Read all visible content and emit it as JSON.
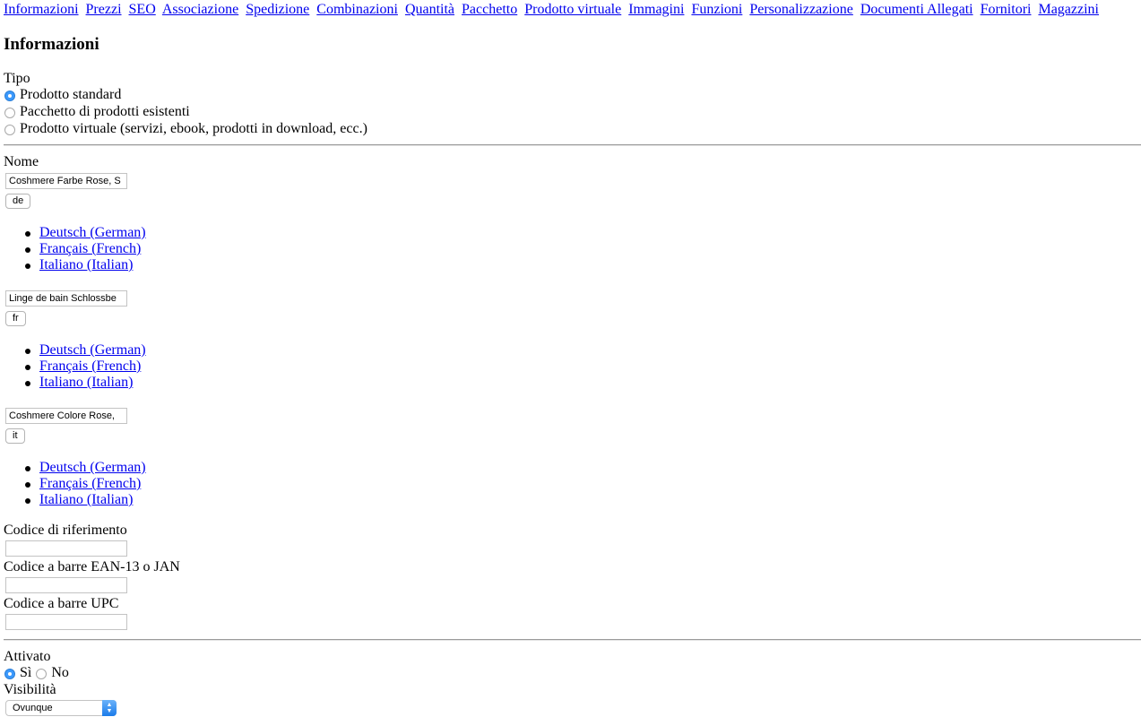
{
  "tabs": [
    "Informazioni",
    "Prezzi",
    "SEO",
    "Associazione",
    "Spedizione",
    "Combinazioni",
    "Quantità",
    "Pacchetto",
    "Prodotto virtuale",
    "Immagini",
    "Funzioni",
    "Personalizzazione",
    "Documenti Allegati",
    "Fornitori",
    "Magazzini"
  ],
  "section_title": "Informazioni",
  "tipo": {
    "label": "Tipo",
    "options": [
      {
        "label": "Prodotto standard",
        "checked": true
      },
      {
        "label": "Pacchetto di prodotti esistenti",
        "checked": false
      },
      {
        "label": "Prodotto virtuale (servizi, ebook, prodotti in download, ecc.)",
        "checked": false
      }
    ]
  },
  "nome": {
    "label": "Nome",
    "fields": [
      {
        "value": "Coshmere Farbe Rose, S",
        "lang_button": "de",
        "languages": [
          "Deutsch (German)",
          "Français (French)",
          "Italiano (Italian)"
        ]
      },
      {
        "value": "Linge de bain Schlossbe",
        "lang_button": "fr",
        "languages": [
          "Deutsch (German)",
          "Français (French)",
          "Italiano (Italian)"
        ]
      },
      {
        "value": "Coshmere Colore Rose, ",
        "lang_button": "it",
        "languages": [
          "Deutsch (German)",
          "Français (French)",
          "Italiano (Italian)"
        ]
      }
    ]
  },
  "codice_riferimento": {
    "label": "Codice di riferimento",
    "value": ""
  },
  "ean": {
    "label": "Codice a barre EAN-13 o JAN",
    "value": ""
  },
  "upc": {
    "label": "Codice a barre UPC",
    "value": ""
  },
  "attivato": {
    "label": "Attivato",
    "yes": "Sì",
    "no": "No",
    "selected": "Sì"
  },
  "visibilita": {
    "label": "Visibilità",
    "selected": "Ovunque"
  }
}
